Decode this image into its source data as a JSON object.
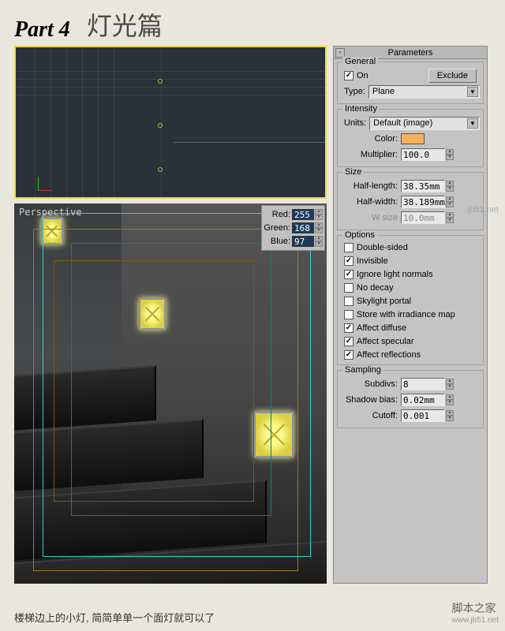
{
  "title": {
    "part": "Part 4",
    "chapter": "灯光篇"
  },
  "viewports": {
    "perspective_label": "Perspective"
  },
  "rgb": {
    "red_label": "Red:",
    "red": "255",
    "green_label": "Green:",
    "green": "168",
    "blue_label": "Blue:",
    "blue": "97"
  },
  "panel": {
    "header": "Parameters",
    "general": {
      "title": "General",
      "on_label": "On",
      "on": true,
      "exclude_label": "Exclude",
      "type_label": "Type:",
      "type_value": "Plane"
    },
    "intensity": {
      "title": "Intensity",
      "units_label": "Units:",
      "units_value": "Default (image)",
      "color_label": "Color:",
      "color_hex": "#f5b060",
      "multiplier_label": "Multiplier:",
      "multiplier": "100.0"
    },
    "size": {
      "title": "Size",
      "half_length_label": "Half-length:",
      "half_length": "38.35mm",
      "half_width_label": "Half-width:",
      "half_width": "38.189mm",
      "w_size_label": "W size",
      "w_size": "10.0mm"
    },
    "options": {
      "title": "Options",
      "double_sided": {
        "label": "Double-sided",
        "checked": false
      },
      "invisible": {
        "label": "Invisible",
        "checked": true
      },
      "ignore_light_normals": {
        "label": "Ignore light normals",
        "checked": true
      },
      "no_decay": {
        "label": "No decay",
        "checked": false
      },
      "skylight_portal": {
        "label": "Skylight portal",
        "checked": false
      },
      "store_irradiance": {
        "label": "Store with irradiance map",
        "checked": false
      },
      "affect_diffuse": {
        "label": "Affect diffuse",
        "checked": true
      },
      "affect_specular": {
        "label": "Affect specular",
        "checked": true
      },
      "affect_reflections": {
        "label": "Affect reflections",
        "checked": true
      }
    },
    "sampling": {
      "title": "Sampling",
      "subdivs_label": "Subdivs:",
      "subdivs": "8",
      "shadow_bias_label": "Shadow bias:",
      "shadow_bias": "0.02mm",
      "cutoff_label": "Cutoff:",
      "cutoff": "0.001"
    }
  },
  "caption": "楼梯边上的小灯, 简简单单一个面灯就可以了",
  "watermark1": "jb51.net",
  "watermark2": {
    "zh": "脚本之家",
    "en": "www.jb51.net"
  }
}
